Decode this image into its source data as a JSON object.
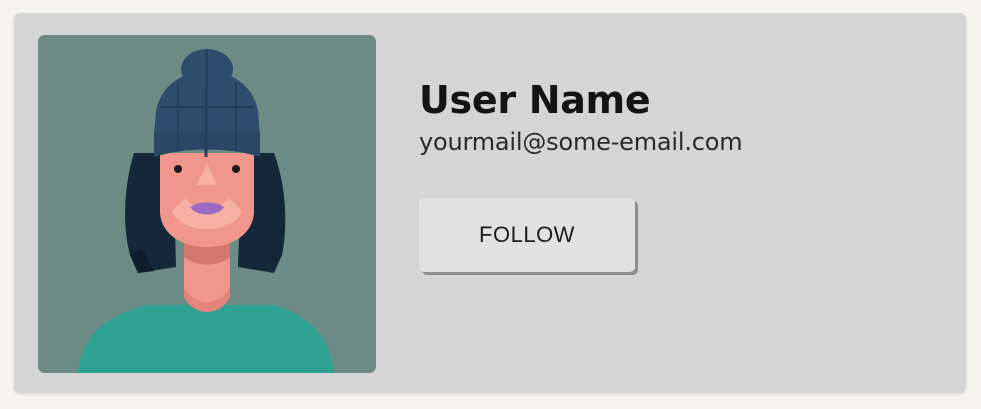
{
  "profile": {
    "name": "User Name",
    "email": "yourmail@some-email.com",
    "follow_label": "FOLLOW",
    "avatar_icon": "woman-avatar-illustration"
  },
  "colors": {
    "card_background": "#d5d5d5",
    "avatar_background": "#6b8b84",
    "button_background": "#e1e1e1",
    "button_shadow": "#8e8e8e"
  }
}
